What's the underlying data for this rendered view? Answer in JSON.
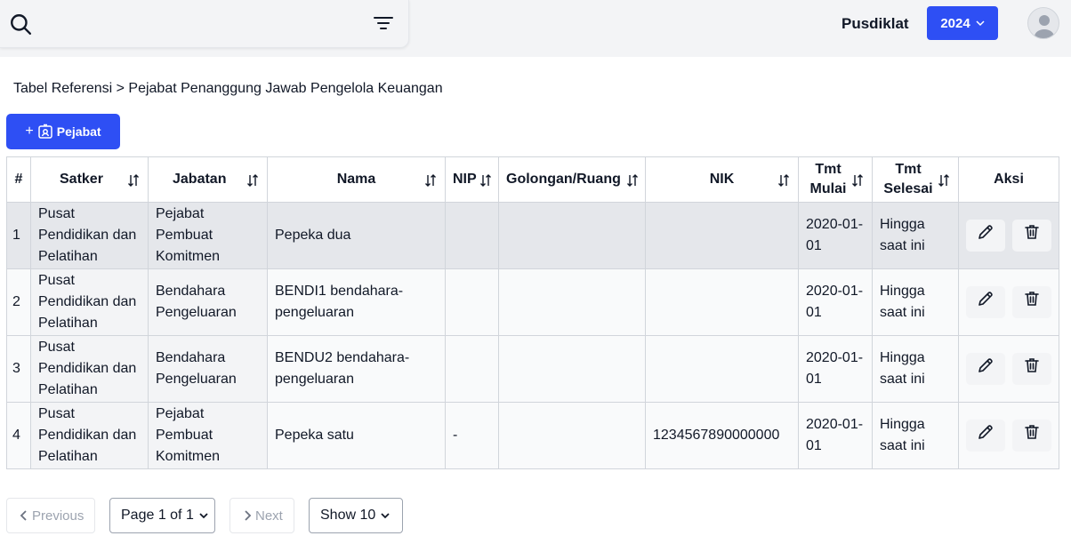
{
  "header": {
    "org_label": "Pusdiklat",
    "year": "2024",
    "accent_color": "#2e4ff4"
  },
  "breadcrumb": "Tabel Referensi > Pejabat Penanggung Jawab Pengelola Keuangan",
  "add_button_label": "Pejabat",
  "table": {
    "headers": {
      "no": "#",
      "satker": "Satker",
      "jabatan": "Jabatan",
      "nama": "Nama",
      "nip": "NIP",
      "golongan": "Golongan/Ruang",
      "nik": "NIK",
      "tmt_mulai": "Tmt Mulai",
      "tmt_selesai": "Tmt Selesai",
      "aksi": "Aksi"
    },
    "rows": [
      {
        "no": "1",
        "satker": "Pusat Pendidikan dan Pelatihan",
        "jabatan": "Pejabat Pembuat Komitmen",
        "nama": "Pepeka dua",
        "nip": "",
        "golongan": "",
        "nik": "",
        "tmt_mulai": "2020-01-01",
        "tmt_selesai": "Hingga saat ini"
      },
      {
        "no": "2",
        "satker": "Pusat Pendidikan dan Pelatihan",
        "jabatan": "Bendahara Pengeluaran",
        "nama": "BENDI1 bendahara-pengeluaran",
        "nip": "",
        "golongan": "",
        "nik": "",
        "tmt_mulai": "2020-01-01",
        "tmt_selesai": "Hingga saat ini"
      },
      {
        "no": "3",
        "satker": "Pusat Pendidikan dan Pelatihan",
        "jabatan": "Bendahara Pengeluaran",
        "nama": "BENDU2 bendahara-pengeluaran",
        "nip": "",
        "golongan": "",
        "nik": "",
        "tmt_mulai": "2020-01-01",
        "tmt_selesai": "Hingga saat ini"
      },
      {
        "no": "4",
        "satker": "Pusat Pendidikan dan Pelatihan",
        "jabatan": "Pejabat Pembuat Komitmen",
        "nama": "Pepeka satu",
        "nip": "-",
        "golongan": "",
        "nik": "1234567890000000",
        "tmt_mulai": "2020-01-01",
        "tmt_selesai": "Hingga saat ini"
      }
    ]
  },
  "pagination": {
    "previous_label": "Previous",
    "page_label": "Page 1 of 1",
    "next_label": "Next",
    "show_label": "Show 10"
  }
}
